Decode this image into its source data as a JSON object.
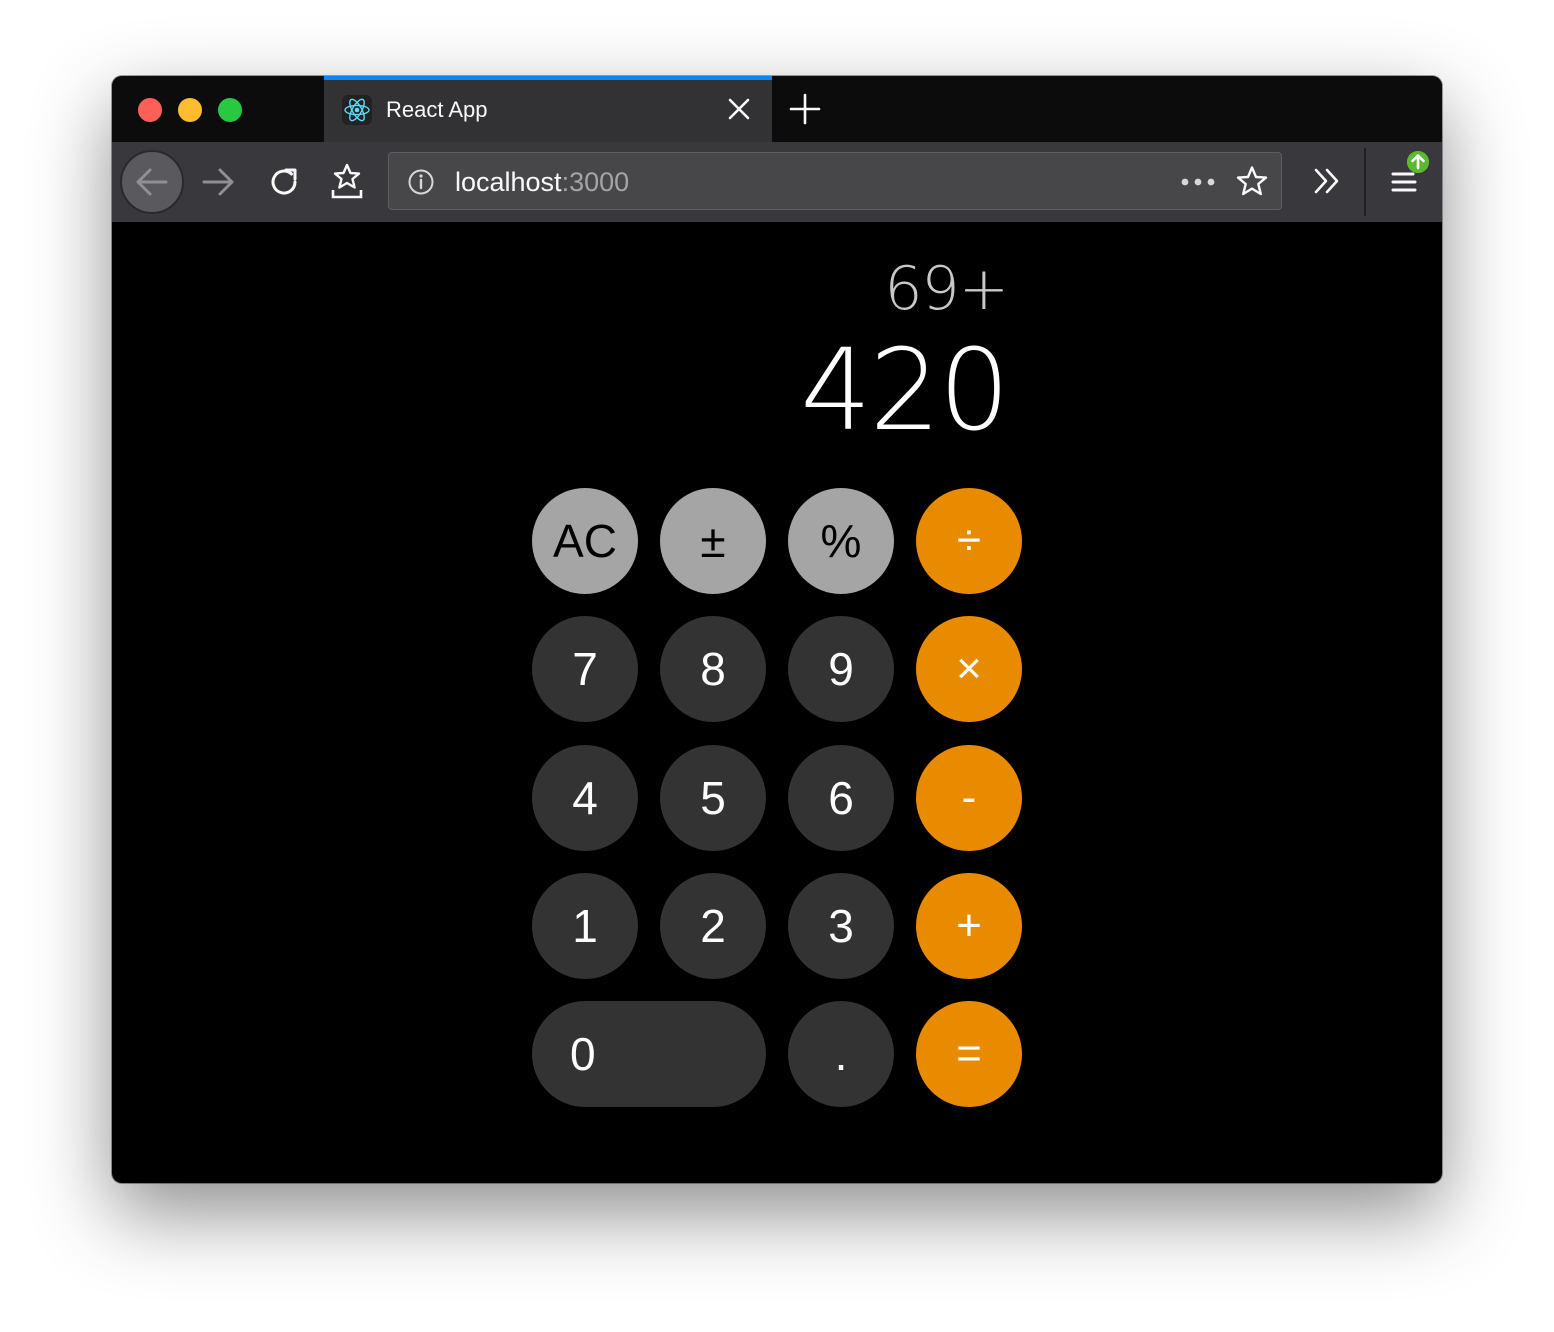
{
  "browser": {
    "tab": {
      "title": "React App"
    },
    "url": {
      "host": "localhost",
      "port": ":3000"
    }
  },
  "calculator": {
    "expression": "69+",
    "display": "420",
    "keys": {
      "clear": "AC",
      "sign": "±",
      "percent": "%",
      "divide": "÷",
      "seven": "7",
      "eight": "8",
      "nine": "9",
      "multiply": "×",
      "four": "4",
      "five": "5",
      "six": "6",
      "subtract": "-",
      "one": "1",
      "two": "2",
      "three": "3",
      "add": "+",
      "zero": "0",
      "decimal": ".",
      "equals": "="
    }
  },
  "colors": {
    "function_key": "#a5a5a5",
    "number_key": "#333333",
    "operator_key": "#e88b00",
    "tab_accent": "#0a84ff"
  }
}
